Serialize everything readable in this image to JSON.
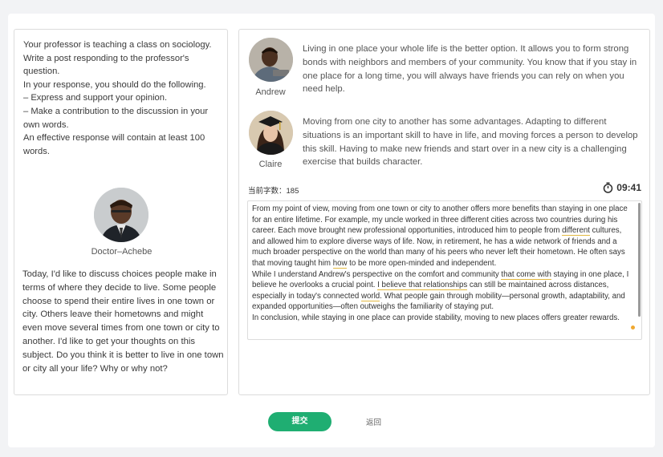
{
  "prompt": {
    "lines": [
      "Your professor is teaching a class on sociology. Write a post responding to the professor's question.",
      "In your response, you should do the following.",
      "– Express and support your opinion.",
      "– Make a contribution to the discussion in your own words.",
      "An effective response will contain at least 100 words."
    ]
  },
  "professor": {
    "name": "Doctor–Achebe",
    "post": "Today, I'd like to discuss choices people make in terms of where they decide to live. Some people choose to spend their entire lives in one town or city. Others leave their hometowns and might even move several times from one town or city to another. I'd like to get your thoughts on this subject. Do you think it is better to live in one town or city all your life? Why or why not?"
  },
  "students": [
    {
      "name": "Andrew",
      "post": "Living in one place your whole life is the better option. It allows you to form strong bonds with neighbors and members of your community. You know that if you stay in one place for a long time, you will always have friends you can rely on when you need help."
    },
    {
      "name": "Claire",
      "post": "Moving from one city to another has some advantages. Adapting to different situations is an important skill to have in life, and moving forces a person to develop this skill. Having to make new friends and start over in a new city is a challenging exercise that builds character."
    }
  ],
  "status": {
    "word_count_label": "当前字数：",
    "word_count": "185",
    "timer": "09:41"
  },
  "response": {
    "p1_a": "From my point of view, moving from one town or city to another offers more benefits than staying in one place for an entire lifetime. For example, my uncle worked in three different cities across two countries during his career. Each move brought new professional opportunities, introduced him to people from ",
    "p1_hl1": "different",
    "p1_b": " cultures, and allowed him to explore diverse ways of life. Now, in retirement, he has a wide network of friends and a much broader perspective on the world than many of his peers who never left their hometown. He often says that moving taught him ",
    "p1_hl2": "how",
    "p1_c": " to be more open-minded and independent.",
    "p2_a": "While I understand Andrew's perspective on the comfort and community ",
    "p2_hl1": "that come with",
    "p2_b": " staying in one place, I believe he overlooks a crucial point. ",
    "p2_hl2": "I believe that relationships",
    "p2_c": " can still be maintained across distances, especially in today's connected ",
    "p2_hl3": "world",
    "p2_d": ". What people gain through mobility—personal growth, adaptability, and expanded opportunities—often outweighs the familiarity of staying put.",
    "p3": "In conclusion, while staying in one place can provide stability, moving to new places offers greater rewards."
  },
  "actions": {
    "submit_label": "提交",
    "back_label": "返回"
  },
  "colors": {
    "submit": "#1fae72",
    "highlight": "#e3b940"
  }
}
